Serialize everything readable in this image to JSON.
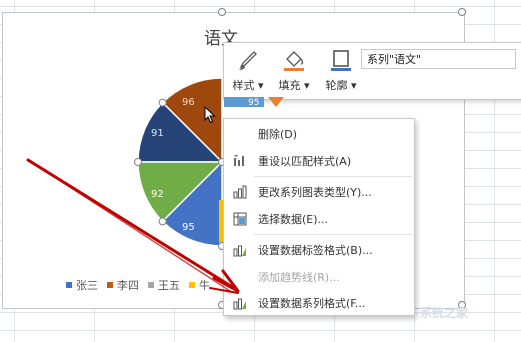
{
  "chart": {
    "title": "语文",
    "labels": {
      "s0": "96",
      "s1": "91",
      "s2": "92",
      "s3": "95",
      "top": "95"
    },
    "legend": [
      {
        "label": "张三",
        "color": "#4472c4"
      },
      {
        "label": "李四",
        "color": "#c55a11"
      },
      {
        "label": "王五",
        "color": "#a5a5a5"
      },
      {
        "label": "牛",
        "color": "#ffc000"
      }
    ],
    "colors": {
      "brown": "#9e480e",
      "navy": "#264478",
      "green": "#70ad47",
      "blue": "#4472c4",
      "lightblue": "#5b9bd5",
      "orange": "#ed7d31",
      "gold": "#ffc000"
    }
  },
  "mini_toolbar": {
    "style_label": "样式",
    "fill_label": "填充",
    "outline_label": "轮廓",
    "series_value": "系列\"语文\""
  },
  "context_menu": {
    "items": [
      {
        "label": "删除(D)",
        "icon": "none",
        "enabled": true
      },
      {
        "label": "重设以匹配样式(A)",
        "icon": "reset-style-icon",
        "enabled": true
      },
      {
        "label": "更改系列图表类型(Y)...",
        "icon": "chart-type-icon",
        "enabled": true
      },
      {
        "label": "选择数据(E)...",
        "icon": "select-data-icon",
        "enabled": true
      },
      {
        "label": "设置数据标签格式(B)...",
        "icon": "label-format-icon",
        "enabled": true
      },
      {
        "label": "添加趋势线(R)...",
        "icon": "none",
        "enabled": false
      },
      {
        "label": "设置数据系列格式(F...",
        "icon": "series-format-icon",
        "enabled": true
      }
    ]
  },
  "watermark": "系统之家"
}
